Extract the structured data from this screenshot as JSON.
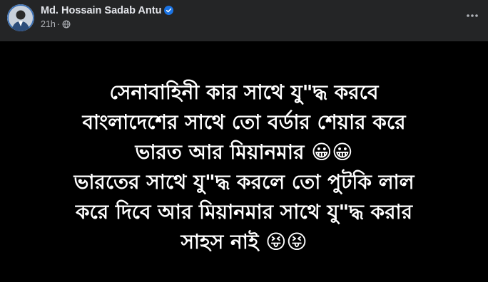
{
  "post": {
    "author": {
      "name": "Md. Hossain Sadab Antu",
      "verified": true,
      "avatar_icon": "profile-photo"
    },
    "meta": {
      "timestamp": "21h",
      "separator": "·",
      "privacy_icon": "globe-icon"
    },
    "more_icon": "more-horizontal-icon",
    "lines": [
      "সেনাবাহিনী কার সাথে যু\"দ্ধ করবে",
      "বাংলাদেশের সাথে তো বর্ডার শেয়ার করে",
      "ভারত আর মিয়ানমার 😀😀",
      "ভারতের সাথে যু\"দ্ধ করলে তো পুটকি লাল",
      "করে দিবে আর মিয়ানমার সাথে যু\"দ্ধ করার",
      "সাহস নাই 😝😝"
    ]
  },
  "colors": {
    "card_background": "#242526",
    "content_background": "#000000",
    "primary_text": "#e4e6eb",
    "secondary_text": "#b0b3b8",
    "verified_blue": "#1b74e4"
  }
}
